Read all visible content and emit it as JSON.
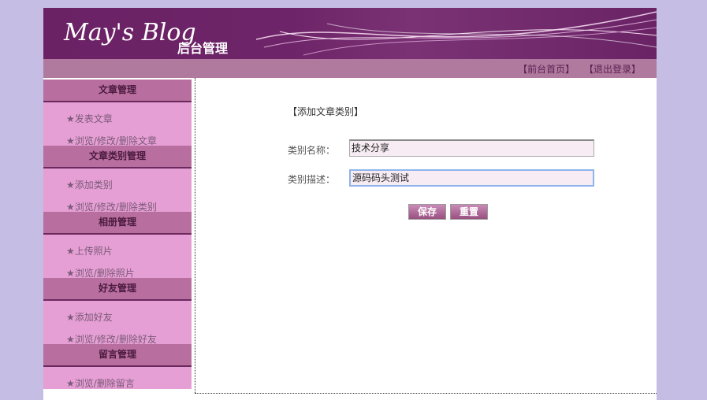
{
  "banner": {
    "logo": "May's Blog",
    "subtitle": "后台管理"
  },
  "nav": {
    "home": "【前台首页】",
    "logout": "【退出登录】"
  },
  "sidebar": [
    {
      "title": "文章管理",
      "items": [
        "★发表文章",
        "★浏览/修改/删除文章"
      ]
    },
    {
      "title": "文章类别管理",
      "items": [
        "★添加类别",
        "★浏览/修改/删除类别"
      ]
    },
    {
      "title": "相册管理",
      "items": [
        "★上传照片",
        "★浏览/删除照片"
      ]
    },
    {
      "title": "好友管理",
      "items": [
        "★添加好友",
        "★浏览/修改/删除好友"
      ]
    },
    {
      "title": "留言管理",
      "items": [
        "★浏览/删除留言"
      ]
    }
  ],
  "form": {
    "title": "【添加文章类别】",
    "name_label": "类别名称：",
    "name_value": "技术分享",
    "desc_label": "类别描述：",
    "desc_value": "源码码头测试",
    "save": "保存",
    "reset": "重置"
  }
}
